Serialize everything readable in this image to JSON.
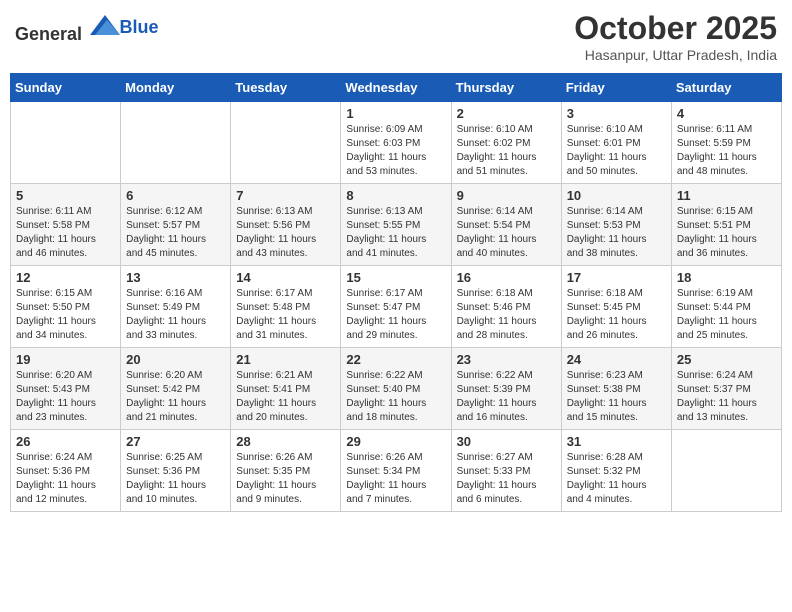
{
  "header": {
    "logo_general": "General",
    "logo_blue": "Blue",
    "month": "October 2025",
    "location": "Hasanpur, Uttar Pradesh, India"
  },
  "weekdays": [
    "Sunday",
    "Monday",
    "Tuesday",
    "Wednesday",
    "Thursday",
    "Friday",
    "Saturday"
  ],
  "weeks": [
    [
      {
        "day": "",
        "sunrise": "",
        "sunset": "",
        "daylight": ""
      },
      {
        "day": "",
        "sunrise": "",
        "sunset": "",
        "daylight": ""
      },
      {
        "day": "",
        "sunrise": "",
        "sunset": "",
        "daylight": ""
      },
      {
        "day": "1",
        "sunrise": "Sunrise: 6:09 AM",
        "sunset": "Sunset: 6:03 PM",
        "daylight": "Daylight: 11 hours and 53 minutes."
      },
      {
        "day": "2",
        "sunrise": "Sunrise: 6:10 AM",
        "sunset": "Sunset: 6:02 PM",
        "daylight": "Daylight: 11 hours and 51 minutes."
      },
      {
        "day": "3",
        "sunrise": "Sunrise: 6:10 AM",
        "sunset": "Sunset: 6:01 PM",
        "daylight": "Daylight: 11 hours and 50 minutes."
      },
      {
        "day": "4",
        "sunrise": "Sunrise: 6:11 AM",
        "sunset": "Sunset: 5:59 PM",
        "daylight": "Daylight: 11 hours and 48 minutes."
      }
    ],
    [
      {
        "day": "5",
        "sunrise": "Sunrise: 6:11 AM",
        "sunset": "Sunset: 5:58 PM",
        "daylight": "Daylight: 11 hours and 46 minutes."
      },
      {
        "day": "6",
        "sunrise": "Sunrise: 6:12 AM",
        "sunset": "Sunset: 5:57 PM",
        "daylight": "Daylight: 11 hours and 45 minutes."
      },
      {
        "day": "7",
        "sunrise": "Sunrise: 6:13 AM",
        "sunset": "Sunset: 5:56 PM",
        "daylight": "Daylight: 11 hours and 43 minutes."
      },
      {
        "day": "8",
        "sunrise": "Sunrise: 6:13 AM",
        "sunset": "Sunset: 5:55 PM",
        "daylight": "Daylight: 11 hours and 41 minutes."
      },
      {
        "day": "9",
        "sunrise": "Sunrise: 6:14 AM",
        "sunset": "Sunset: 5:54 PM",
        "daylight": "Daylight: 11 hours and 40 minutes."
      },
      {
        "day": "10",
        "sunrise": "Sunrise: 6:14 AM",
        "sunset": "Sunset: 5:53 PM",
        "daylight": "Daylight: 11 hours and 38 minutes."
      },
      {
        "day": "11",
        "sunrise": "Sunrise: 6:15 AM",
        "sunset": "Sunset: 5:51 PM",
        "daylight": "Daylight: 11 hours and 36 minutes."
      }
    ],
    [
      {
        "day": "12",
        "sunrise": "Sunrise: 6:15 AM",
        "sunset": "Sunset: 5:50 PM",
        "daylight": "Daylight: 11 hours and 34 minutes."
      },
      {
        "day": "13",
        "sunrise": "Sunrise: 6:16 AM",
        "sunset": "Sunset: 5:49 PM",
        "daylight": "Daylight: 11 hours and 33 minutes."
      },
      {
        "day": "14",
        "sunrise": "Sunrise: 6:17 AM",
        "sunset": "Sunset: 5:48 PM",
        "daylight": "Daylight: 11 hours and 31 minutes."
      },
      {
        "day": "15",
        "sunrise": "Sunrise: 6:17 AM",
        "sunset": "Sunset: 5:47 PM",
        "daylight": "Daylight: 11 hours and 29 minutes."
      },
      {
        "day": "16",
        "sunrise": "Sunrise: 6:18 AM",
        "sunset": "Sunset: 5:46 PM",
        "daylight": "Daylight: 11 hours and 28 minutes."
      },
      {
        "day": "17",
        "sunrise": "Sunrise: 6:18 AM",
        "sunset": "Sunset: 5:45 PM",
        "daylight": "Daylight: 11 hours and 26 minutes."
      },
      {
        "day": "18",
        "sunrise": "Sunrise: 6:19 AM",
        "sunset": "Sunset: 5:44 PM",
        "daylight": "Daylight: 11 hours and 25 minutes."
      }
    ],
    [
      {
        "day": "19",
        "sunrise": "Sunrise: 6:20 AM",
        "sunset": "Sunset: 5:43 PM",
        "daylight": "Daylight: 11 hours and 23 minutes."
      },
      {
        "day": "20",
        "sunrise": "Sunrise: 6:20 AM",
        "sunset": "Sunset: 5:42 PM",
        "daylight": "Daylight: 11 hours and 21 minutes."
      },
      {
        "day": "21",
        "sunrise": "Sunrise: 6:21 AM",
        "sunset": "Sunset: 5:41 PM",
        "daylight": "Daylight: 11 hours and 20 minutes."
      },
      {
        "day": "22",
        "sunrise": "Sunrise: 6:22 AM",
        "sunset": "Sunset: 5:40 PM",
        "daylight": "Daylight: 11 hours and 18 minutes."
      },
      {
        "day": "23",
        "sunrise": "Sunrise: 6:22 AM",
        "sunset": "Sunset: 5:39 PM",
        "daylight": "Daylight: 11 hours and 16 minutes."
      },
      {
        "day": "24",
        "sunrise": "Sunrise: 6:23 AM",
        "sunset": "Sunset: 5:38 PM",
        "daylight": "Daylight: 11 hours and 15 minutes."
      },
      {
        "day": "25",
        "sunrise": "Sunrise: 6:24 AM",
        "sunset": "Sunset: 5:37 PM",
        "daylight": "Daylight: 11 hours and 13 minutes."
      }
    ],
    [
      {
        "day": "26",
        "sunrise": "Sunrise: 6:24 AM",
        "sunset": "Sunset: 5:36 PM",
        "daylight": "Daylight: 11 hours and 12 minutes."
      },
      {
        "day": "27",
        "sunrise": "Sunrise: 6:25 AM",
        "sunset": "Sunset: 5:36 PM",
        "daylight": "Daylight: 11 hours and 10 minutes."
      },
      {
        "day": "28",
        "sunrise": "Sunrise: 6:26 AM",
        "sunset": "Sunset: 5:35 PM",
        "daylight": "Daylight: 11 hours and 9 minutes."
      },
      {
        "day": "29",
        "sunrise": "Sunrise: 6:26 AM",
        "sunset": "Sunset: 5:34 PM",
        "daylight": "Daylight: 11 hours and 7 minutes."
      },
      {
        "day": "30",
        "sunrise": "Sunrise: 6:27 AM",
        "sunset": "Sunset: 5:33 PM",
        "daylight": "Daylight: 11 hours and 6 minutes."
      },
      {
        "day": "31",
        "sunrise": "Sunrise: 6:28 AM",
        "sunset": "Sunset: 5:32 PM",
        "daylight": "Daylight: 11 hours and 4 minutes."
      },
      {
        "day": "",
        "sunrise": "",
        "sunset": "",
        "daylight": ""
      }
    ]
  ]
}
